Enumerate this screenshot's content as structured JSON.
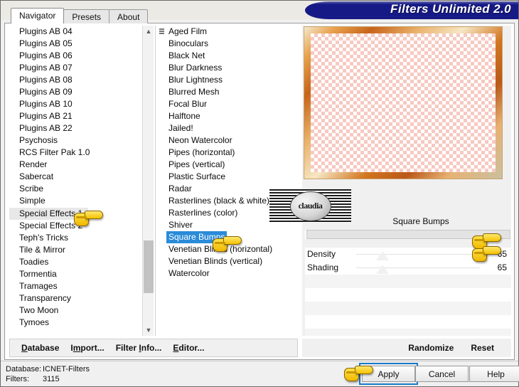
{
  "window": {
    "title": "Filters Unlimited 2.0"
  },
  "tabs": [
    {
      "label": "Navigator",
      "active": true
    },
    {
      "label": "Presets",
      "active": false
    },
    {
      "label": "About",
      "active": false
    }
  ],
  "category_list": {
    "items": [
      "Plugins AB 04",
      "Plugins AB 05",
      "Plugins AB 06",
      "Plugins AB 07",
      "Plugins AB 08",
      "Plugins AB 09",
      "Plugins AB 10",
      "Plugins AB 21",
      "Plugins AB 22",
      "Psychosis",
      "RCS Filter Pak 1.0",
      "Render",
      "Sabercat",
      "Scribe",
      "Simple",
      "Special Effects 1",
      "Special Effects 2",
      "Teph's Tricks",
      "Tile & Mirror",
      "Toadies",
      "Tormentia",
      "Tramages",
      "Transparency",
      "Two Moon",
      "Tymoes"
    ],
    "selected": "Special Effects 1",
    "selected_index": 15
  },
  "filter_list": {
    "items": [
      "Aged Film",
      "Binoculars",
      "Black Net",
      "Blur Darkness",
      "Blur Lightness",
      "Blurred Mesh",
      "Focal Blur",
      "Halftone",
      "Jailed!",
      "Neon Watercolor",
      "Pipes (horizontal)",
      "Pipes (vertical)",
      "Plastic Surface",
      "Radar",
      "Rasterlines (black & white)",
      "Rasterlines (color)",
      "Shiver",
      "Square Bumps",
      "Venetian Blinds (horizontal)",
      "Venetian Blinds (vertical)",
      "Watercolor"
    ],
    "selected": "Square Bumps",
    "selected_index": 17
  },
  "parameters": {
    "title": "Square Bumps",
    "rows": [
      {
        "label": "Density",
        "value": "65"
      },
      {
        "label": "Shading",
        "value": "65"
      }
    ]
  },
  "watermark": {
    "text": "claudia"
  },
  "action_links": [
    {
      "label": "Database",
      "accel": "D"
    },
    {
      "label": "Import...",
      "accel": "I"
    },
    {
      "label": "Filter Info...",
      "accel": "I"
    },
    {
      "label": "Editor...",
      "accel": "E"
    }
  ],
  "preview_actions": [
    {
      "label": "Randomize"
    },
    {
      "label": "Reset"
    }
  ],
  "status": {
    "database_key": "Database:",
    "database_value": "ICNET-Filters",
    "filters_key": "Filters:",
    "filters_value": "3115"
  },
  "buttons": {
    "apply": "Apply",
    "cancel": "Cancel",
    "help": "Help"
  },
  "colors": {
    "title_bar": "#161a86",
    "selection_blue": "#2a8bd8",
    "selection_gray": "#e8e8e8",
    "focus_border": "#1879c9",
    "hand_yellow": "#f5c200"
  }
}
